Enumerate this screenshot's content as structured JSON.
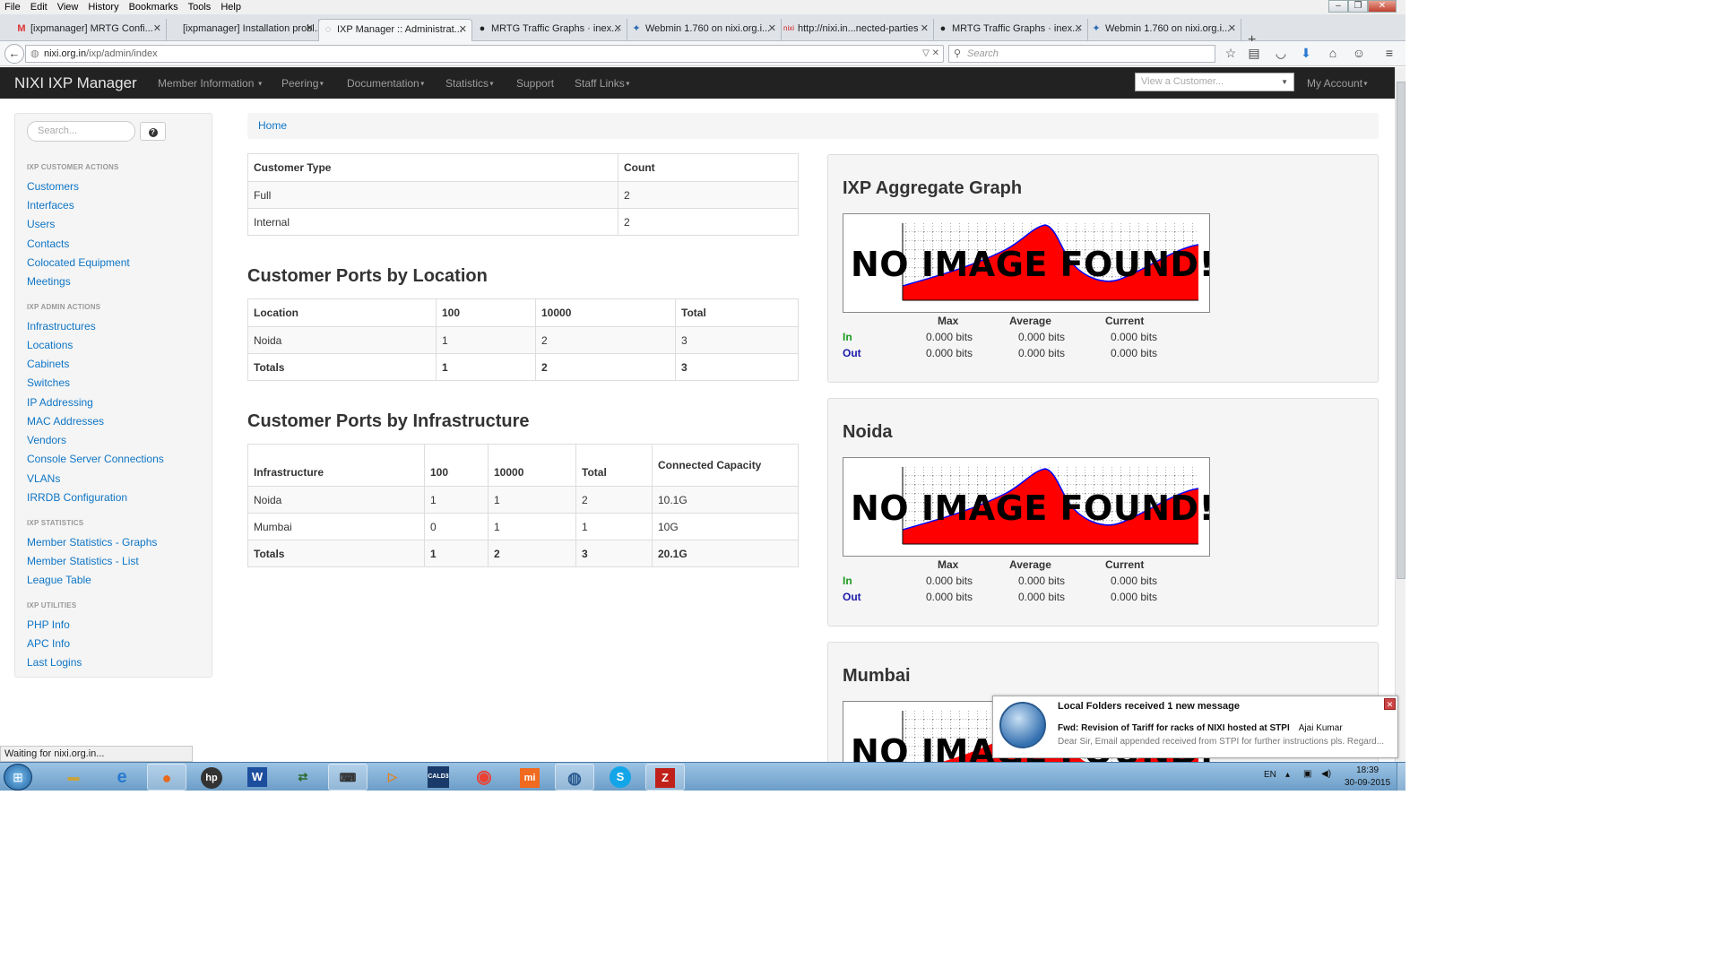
{
  "browser": {
    "menu": [
      "File",
      "Edit",
      "View",
      "History",
      "Bookmarks",
      "Tools",
      "Help"
    ],
    "tabs": [
      {
        "label": "[ixpmanager] MRTG Confi...",
        "icon": "gmail-icon"
      },
      {
        "label": "[ixpmanager] Installation probl...",
        "icon": ""
      },
      {
        "label": "IXP Manager :: Administrat...",
        "icon": "loading-icon",
        "active": true
      },
      {
        "label": "MRTG Traffic Graphs · inex...",
        "icon": "github-icon"
      },
      {
        "label": "Webmin 1.760 on nixi.org.i...",
        "icon": "webmin-icon"
      },
      {
        "label": "http://nixi.in...nected-parties",
        "icon": "nixi-icon"
      },
      {
        "label": "MRTG Traffic Graphs · inex...",
        "icon": "github-icon"
      },
      {
        "label": "Webmin 1.760 on nixi.org.i...",
        "icon": "webmin-icon"
      }
    ],
    "url_host": "nixi.org.in",
    "url_path": "/ixp/admin/index",
    "search_placeholder": "Search",
    "status": "Waiting for nixi.org.in..."
  },
  "app": {
    "brand": "NIXI IXP Manager",
    "nav": [
      "Member Information",
      "Peering",
      "Documentation",
      "Statistics",
      "Support",
      "Staff Links"
    ],
    "view_customer_placeholder": "View a Customer...",
    "my_account": "My Account"
  },
  "sidebar": {
    "search_placeholder": "Search...",
    "help_glyph": "?",
    "sections": [
      {
        "heading": "IXP CUSTOMER ACTIONS",
        "items": [
          "Customers",
          "Interfaces",
          "Users",
          "Contacts",
          "Colocated Equipment",
          "Meetings"
        ]
      },
      {
        "heading": "IXP ADMIN ACTIONS",
        "items": [
          "Infrastructures",
          "Locations",
          "Cabinets",
          "Switches",
          "IP Addressing",
          "MAC Addresses",
          "Vendors",
          "Console Server Connections",
          "VLANs",
          "IRRDB Configuration"
        ]
      },
      {
        "heading": "IXP STATISTICS",
        "items": [
          "Member Statistics - Graphs",
          "Member Statistics - List",
          "League Table"
        ]
      },
      {
        "heading": "IXP UTILITIES",
        "items": [
          "PHP Info",
          "APC Info",
          "Last Logins"
        ]
      }
    ]
  },
  "breadcrumb": "Home",
  "customer_types": {
    "headers": [
      "Customer Type",
      "Count"
    ],
    "rows": [
      [
        "Full",
        "2"
      ],
      [
        "Internal",
        "2"
      ]
    ]
  },
  "ports_by_location": {
    "title": "Customer Ports by Location",
    "headers": [
      "Location",
      "100",
      "10000",
      "Total"
    ],
    "rows": [
      [
        "Noida",
        "1",
        "2",
        "3"
      ]
    ],
    "totals": [
      "Totals",
      "1",
      "2",
      "3"
    ]
  },
  "ports_by_infrastructure": {
    "title": "Customer Ports by Infrastructure",
    "headers": [
      "Infrastructure",
      "100",
      "10000",
      "Total",
      "Connected Capacity"
    ],
    "rows": [
      [
        "Noida",
        "1",
        "1",
        "2",
        "10.1G"
      ],
      [
        "Mumbai",
        "0",
        "1",
        "1",
        "10G"
      ]
    ],
    "totals": [
      "Totals",
      "1",
      "2",
      "3",
      "20.1G"
    ]
  },
  "graphs": [
    {
      "title": "IXP Aggregate Graph",
      "noimage": "NO IMAGE FOUND!",
      "headers": [
        "Max",
        "Average",
        "Current"
      ],
      "in": [
        "In",
        "0.000 bits",
        "0.000 bits",
        "0.000 bits"
      ],
      "out": [
        "Out",
        "0.000 bits",
        "0.000 bits",
        "0.000 bits"
      ]
    },
    {
      "title": "Noida",
      "noimage": "NO IMAGE FOUND!",
      "headers": [
        "Max",
        "Average",
        "Current"
      ],
      "in": [
        "In",
        "0.000 bits",
        "0.000 bits",
        "0.000 bits"
      ],
      "out": [
        "Out",
        "0.000 bits",
        "0.000 bits",
        "0.000 bits"
      ]
    },
    {
      "title": "Mumbai",
      "noimage": "NO IMAGE FOUND!"
    }
  ],
  "notification": {
    "title": "Local Folders received 1 new message",
    "subject": "Fwd: Revision of Tariff for racks of NIXI hosted at STPI",
    "from": "Ajai Kumar",
    "body": "Dear Sir, Email appended received from STPI for further instructions pls. Regard..."
  },
  "taskbar": {
    "lang": "EN",
    "time": "18:39",
    "date": "30-09-2015",
    "apps": [
      "explorer-icon",
      "ie-icon",
      "firefox-icon",
      "hp-icon",
      "word-icon",
      "winscp-icon",
      "putty-icon",
      "media-icon",
      "calc-icon",
      "chrome-icon",
      "mi-icon",
      "thunderbird-icon",
      "skype-icon",
      "filezilla-icon"
    ]
  },
  "colors": {
    "brand_bar": "#222222",
    "link": "#0e75c5",
    "graph_fill": "#ff0000",
    "graph_line": "#0000ff"
  }
}
